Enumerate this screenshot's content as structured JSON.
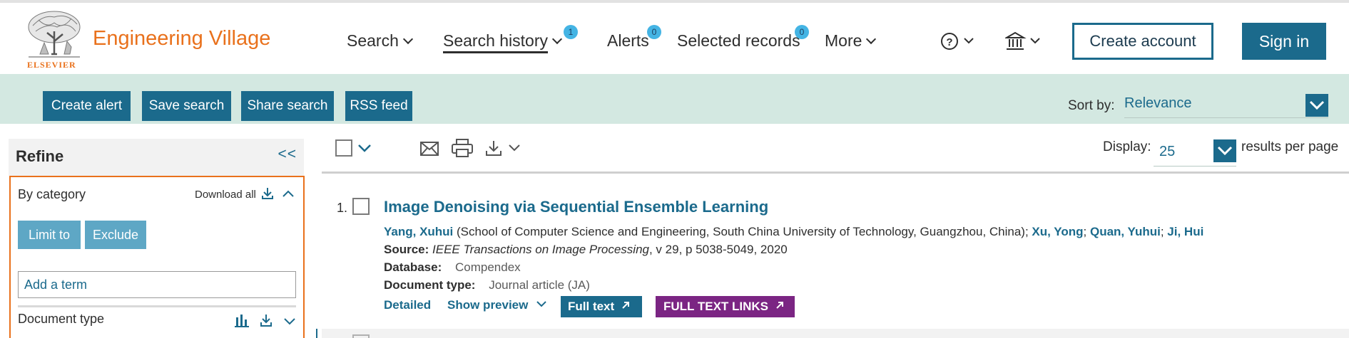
{
  "brand": {
    "name": "Engineering Village",
    "publisher": "ELSEVIER",
    "brand_color": "#e9711c"
  },
  "nav": {
    "search": "Search",
    "search_history": "Search history",
    "search_history_count": "1",
    "alerts": "Alerts",
    "alerts_count": "0",
    "selected_records": "Selected records",
    "selected_records_count": "0",
    "more": "More",
    "help_icon": "question-circle-icon",
    "institution_icon": "institution-icon"
  },
  "account": {
    "create_account": "Create account",
    "sign_in": "Sign in"
  },
  "actions": {
    "create_alert": "Create alert",
    "save_search": "Save search",
    "share_search": "Share search",
    "rss_feed": "RSS feed"
  },
  "sort": {
    "label": "Sort by:",
    "value": "Relevance"
  },
  "refine": {
    "title": "Refine",
    "collapse": "<<",
    "category_label": "By category",
    "download_all": "Download all",
    "limit_to": "Limit to",
    "exclude": "Exclude",
    "add_term_placeholder": "Add a term",
    "document_type": "Document type"
  },
  "toolbar": {
    "display_label": "Display:",
    "display_value": "25",
    "results_per_page": "results per page"
  },
  "results": [
    {
      "number": "1.",
      "title": "Image Denoising via Sequential Ensemble Learning",
      "first_author": "Yang, Xuhui",
      "affiliation": " (School of Computer Science and Engineering, South China University of Technology, Guangzhou, China); ",
      "author_2": "Xu, Yong",
      "author_3": "Quan, Yuhui",
      "author_4": "Ji, Hui",
      "source_label": "Source:",
      "source_journal": "IEEE Transactions on Image Processing",
      "source_details": ", v 29, p 5038-5049, 2020",
      "database_label": "Database:",
      "database_value": "Compendex",
      "doctype_label": "Document type:",
      "doctype_value": "Journal article (JA)",
      "detailed": "Detailed",
      "show_preview": "Show preview",
      "full_text": "Full text",
      "full_text_links": "FULL TEXT LINKS"
    }
  ],
  "colors": {
    "primary": "#1b6a8c",
    "band": "#d3e8e1",
    "badge": "#44b4e4",
    "full_text_links": "#7b2583",
    "refine_border": "#e9711c"
  }
}
